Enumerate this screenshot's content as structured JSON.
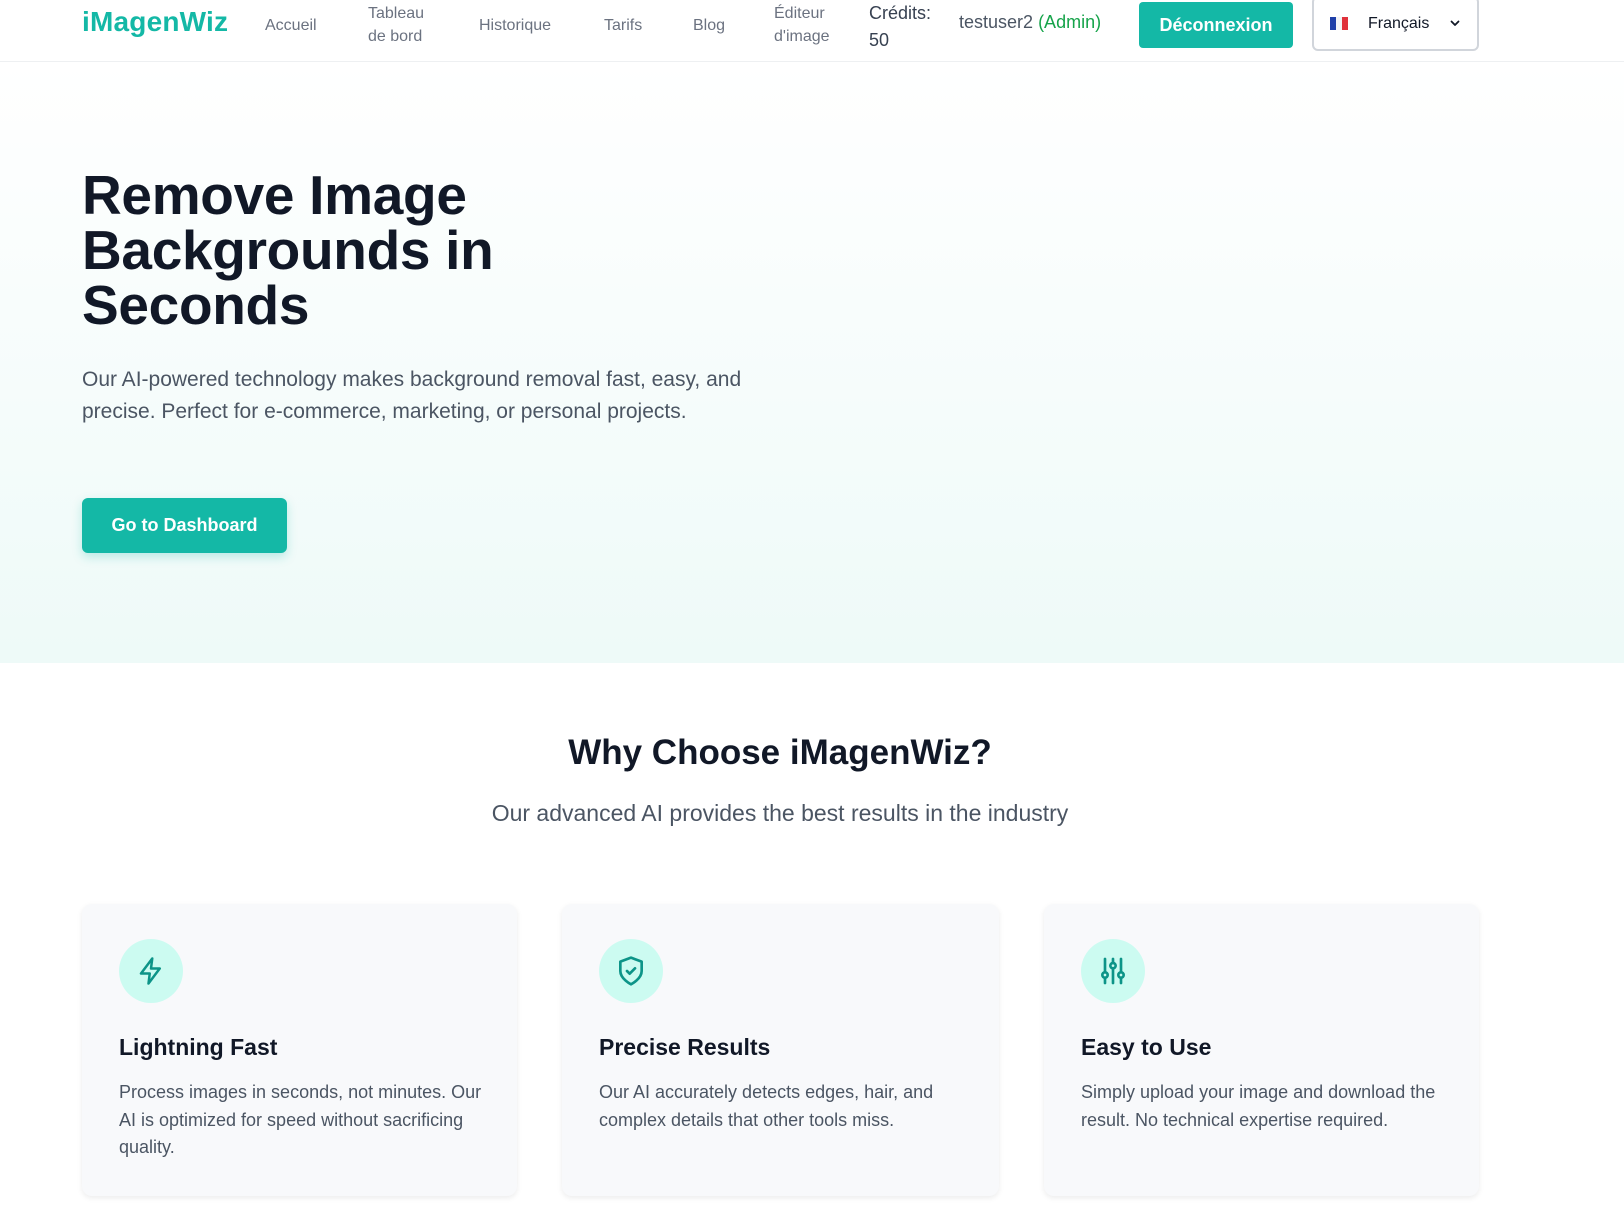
{
  "header": {
    "logo": "iMagenWiz",
    "nav": {
      "accueil": "Accueil",
      "tableau": "Tableau de bord",
      "historique": "Historique",
      "tarifs": "Tarifs",
      "blog": "Blog",
      "editeur": "Éditeur d'image"
    },
    "credits": "Crédits: 50",
    "user": "testuser2",
    "role": "(Admin)",
    "logout": "Déconnexion",
    "language": {
      "selected": "Français",
      "flag_icon": "france-flag-icon"
    }
  },
  "hero": {
    "title": "Remove Image Backgrounds in Seconds",
    "subtitle": "Our AI-powered technology makes background removal fast, easy, and precise. Perfect for e-commerce, marketing, or personal projects.",
    "cta": "Go to Dashboard"
  },
  "features": {
    "title": "Why Choose iMagenWiz?",
    "subtitle": "Our advanced AI provides the best results in the industry",
    "cards": [
      {
        "icon": "lightning-icon",
        "title": "Lightning Fast",
        "text": "Process images in seconds, not minutes. Our AI is optimized for speed without sacrificing quality."
      },
      {
        "icon": "shield-check-icon",
        "title": "Precise Results",
        "text": "Our AI accurately detects edges, hair, and complex details that other tools miss."
      },
      {
        "icon": "sliders-icon",
        "title": "Easy to Use",
        "text": "Simply upload your image and download the result. No technical expertise required."
      }
    ]
  },
  "colors": {
    "brand": "#14b8a6",
    "admin": "#16a34a",
    "icon_bg": "#ccfbf1",
    "icon_stroke": "#0d9488"
  }
}
